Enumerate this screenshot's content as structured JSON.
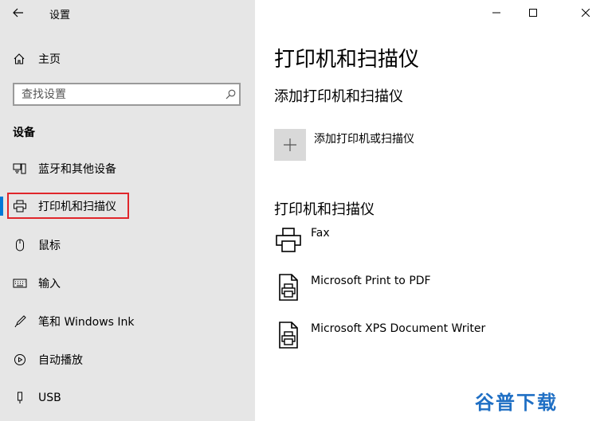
{
  "window": {
    "title": "设置",
    "back_icon": "back-arrow-icon",
    "controls": [
      "minimize-icon",
      "maximize-icon",
      "close-icon"
    ]
  },
  "sidebar": {
    "home_label": "主页",
    "search_placeholder": "查找设置",
    "section_header": "设备",
    "items": [
      {
        "label": "蓝牙和其他设备",
        "icon": "bluetooth-devices-icon"
      },
      {
        "label": "打印机和扫描仪",
        "icon": "printer-icon",
        "selected": true
      },
      {
        "label": "鼠标",
        "icon": "mouse-icon"
      },
      {
        "label": "输入",
        "icon": "keyboard-icon"
      },
      {
        "label": "笔和 Windows Ink",
        "icon": "pen-icon"
      },
      {
        "label": "自动播放",
        "icon": "autoplay-icon"
      },
      {
        "label": "USB",
        "icon": "usb-icon"
      }
    ]
  },
  "main": {
    "page_title": "打印机和扫描仪",
    "add_section_title": "添加打印机和扫描仪",
    "add_button_label": "添加打印机或扫描仪",
    "list_section_title": "打印机和扫描仪",
    "printers": [
      {
        "name": "Fax",
        "icon": "fax-printer-icon"
      },
      {
        "name": "Microsoft Print to PDF",
        "icon": "document-printer-icon"
      },
      {
        "name": "Microsoft XPS Document Writer",
        "icon": "document-printer-icon"
      }
    ]
  },
  "watermark": "谷普下载",
  "colors": {
    "sidebar_bg": "#e6e6e6",
    "accent": "#0078d7",
    "highlight": "#e0262b",
    "watermark": "#1f6fc4"
  }
}
